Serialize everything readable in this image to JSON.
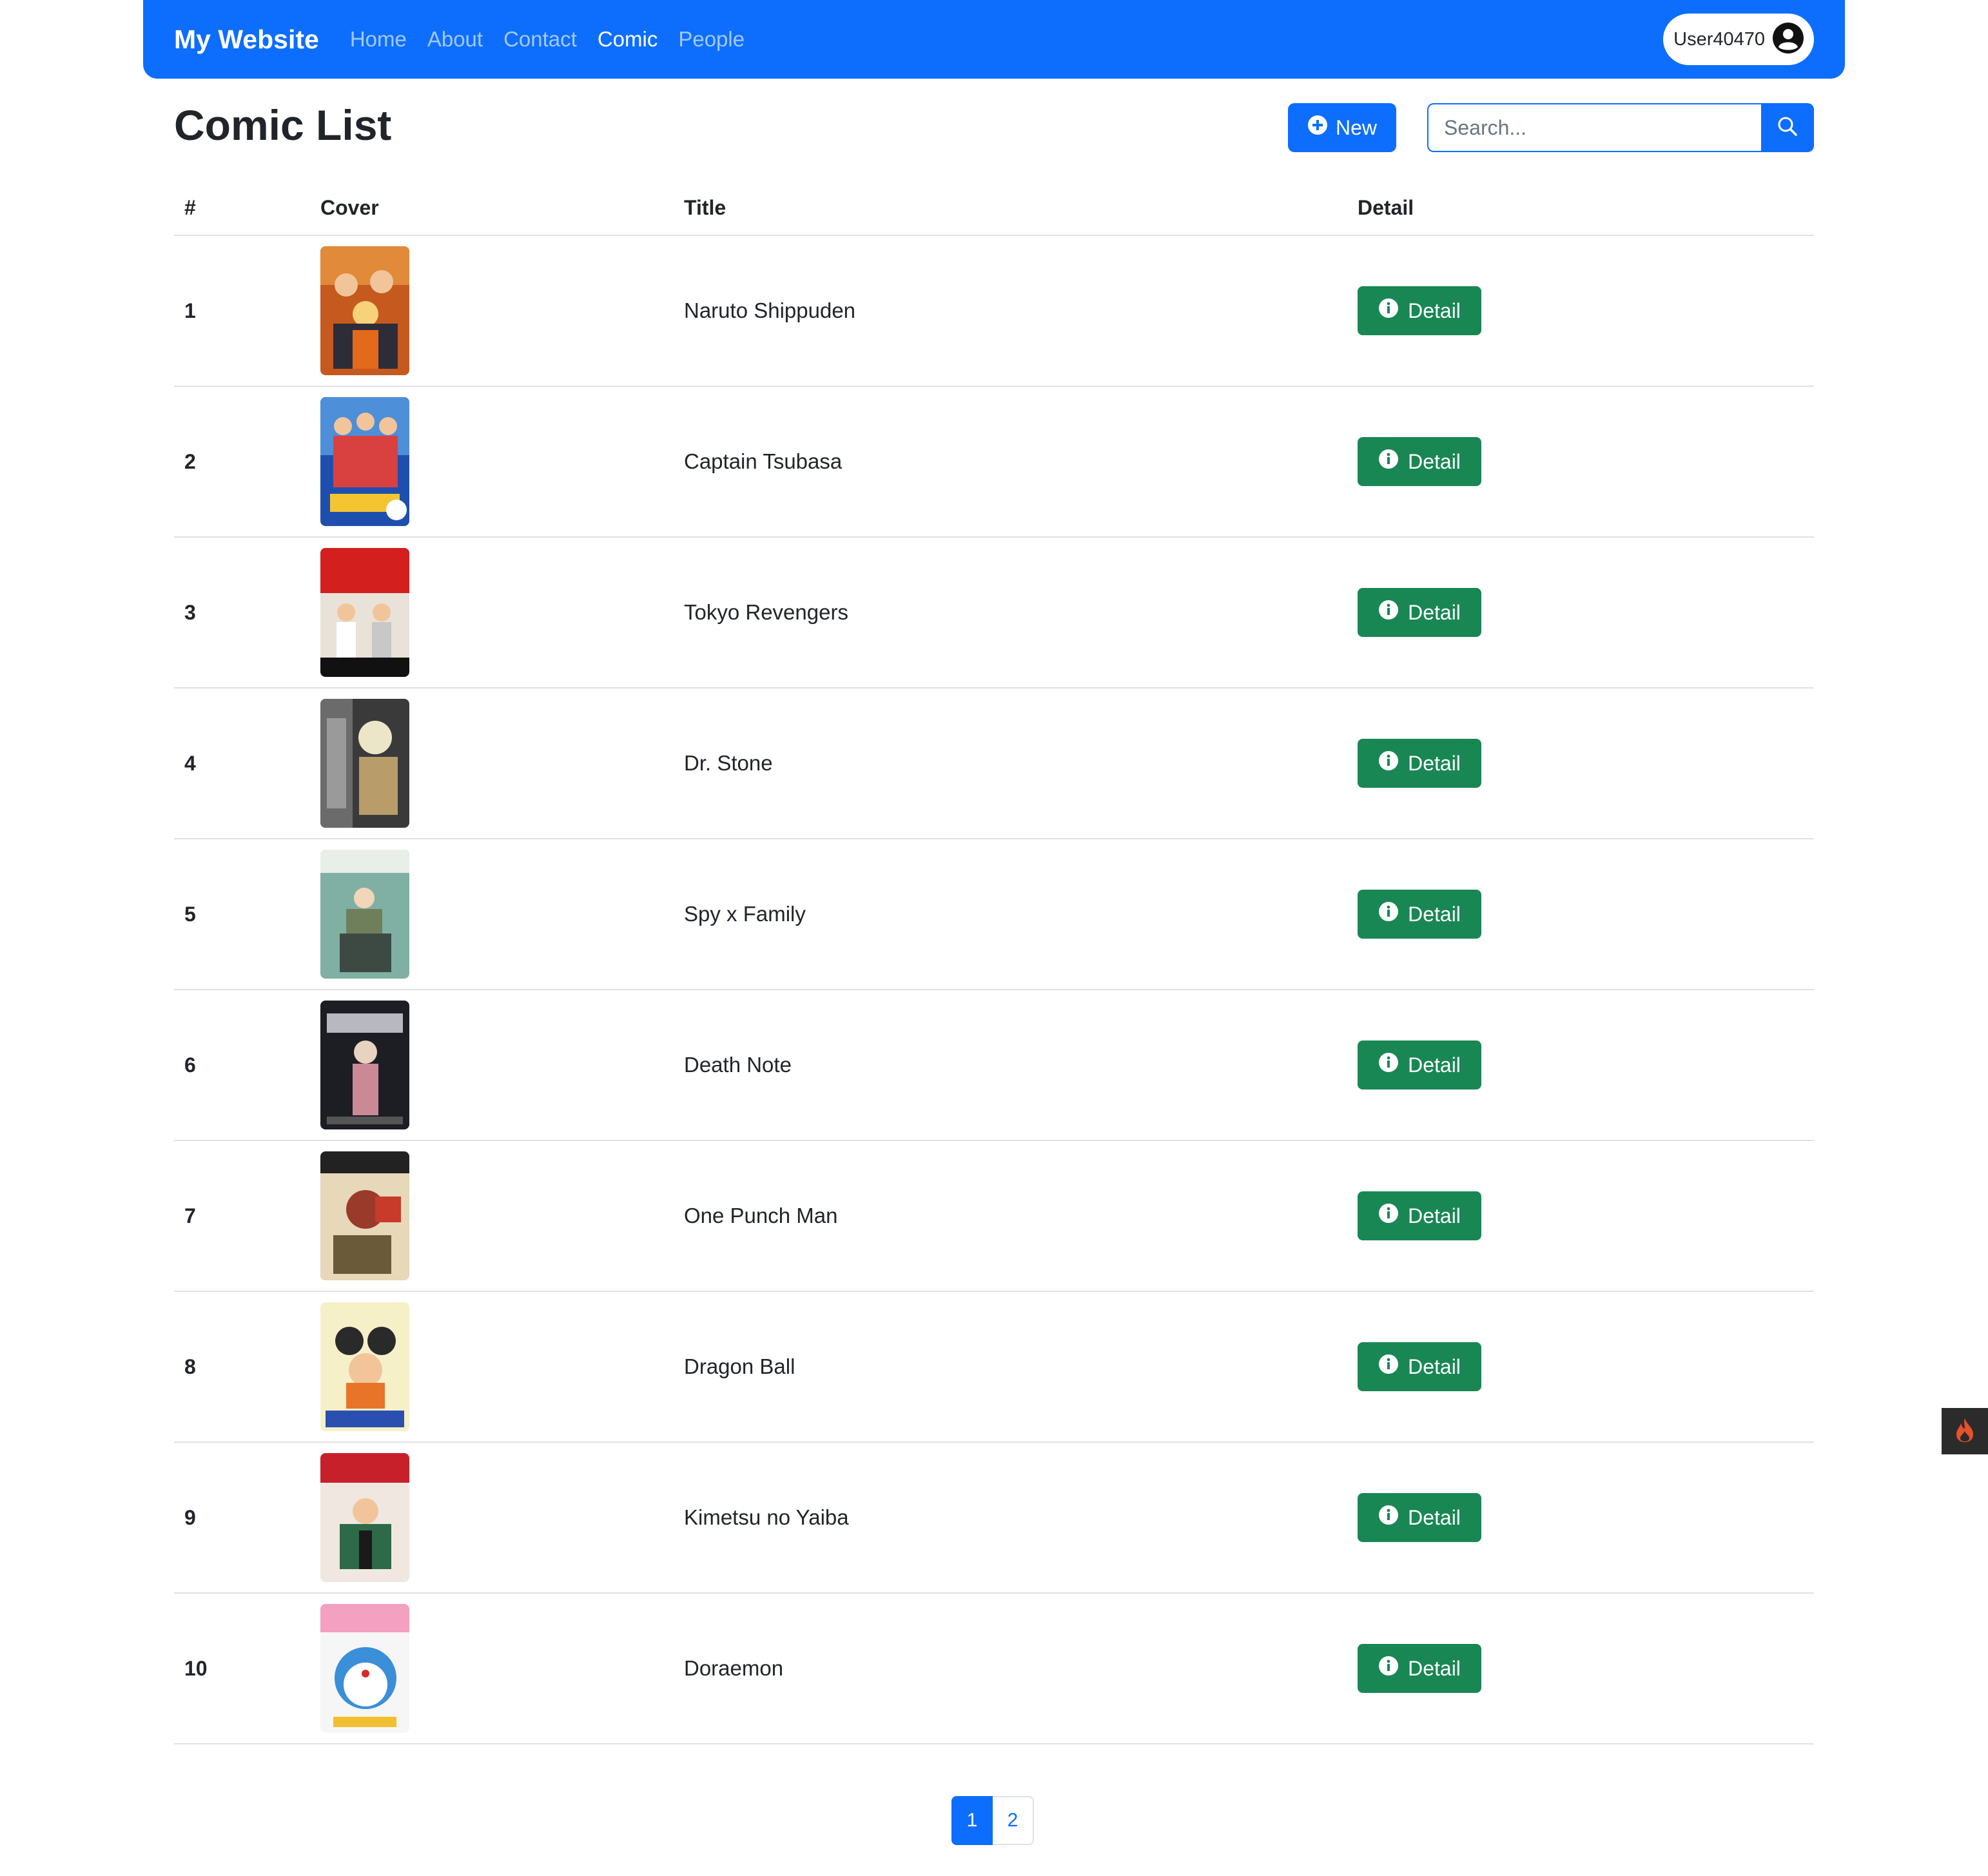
{
  "navbar": {
    "brand": "My Website",
    "links": [
      "Home",
      "About",
      "Contact",
      "Comic",
      "People"
    ],
    "active_link": "Comic",
    "user": "User40470"
  },
  "header": {
    "title": "Comic List",
    "new_label": "New",
    "search_placeholder": "Search..."
  },
  "table": {
    "columns": [
      "#",
      "Cover",
      "Title",
      "Detail"
    ],
    "detail_label": "Detail",
    "rows": [
      {
        "num": "1",
        "title": "Naruto Shippuden"
      },
      {
        "num": "2",
        "title": "Captain Tsubasa"
      },
      {
        "num": "3",
        "title": "Tokyo Revengers"
      },
      {
        "num": "4",
        "title": "Dr. Stone"
      },
      {
        "num": "5",
        "title": "Spy x Family"
      },
      {
        "num": "6",
        "title": "Death Note"
      },
      {
        "num": "7",
        "title": "One Punch Man"
      },
      {
        "num": "8",
        "title": "Dragon Ball"
      },
      {
        "num": "9",
        "title": "Kimetsu no Yaiba"
      },
      {
        "num": "10",
        "title": "Doraemon"
      }
    ]
  },
  "pagination": {
    "pages": [
      "1",
      "2"
    ],
    "current": "1"
  },
  "colors": {
    "primary": "#0d6efd",
    "success": "#198754",
    "border": "#dee2e6"
  },
  "icons": {
    "user": "person-circle-icon",
    "new": "plus-circle-icon",
    "search": "search-icon",
    "detail": "info-circle-icon",
    "widget": "flame-icon"
  }
}
